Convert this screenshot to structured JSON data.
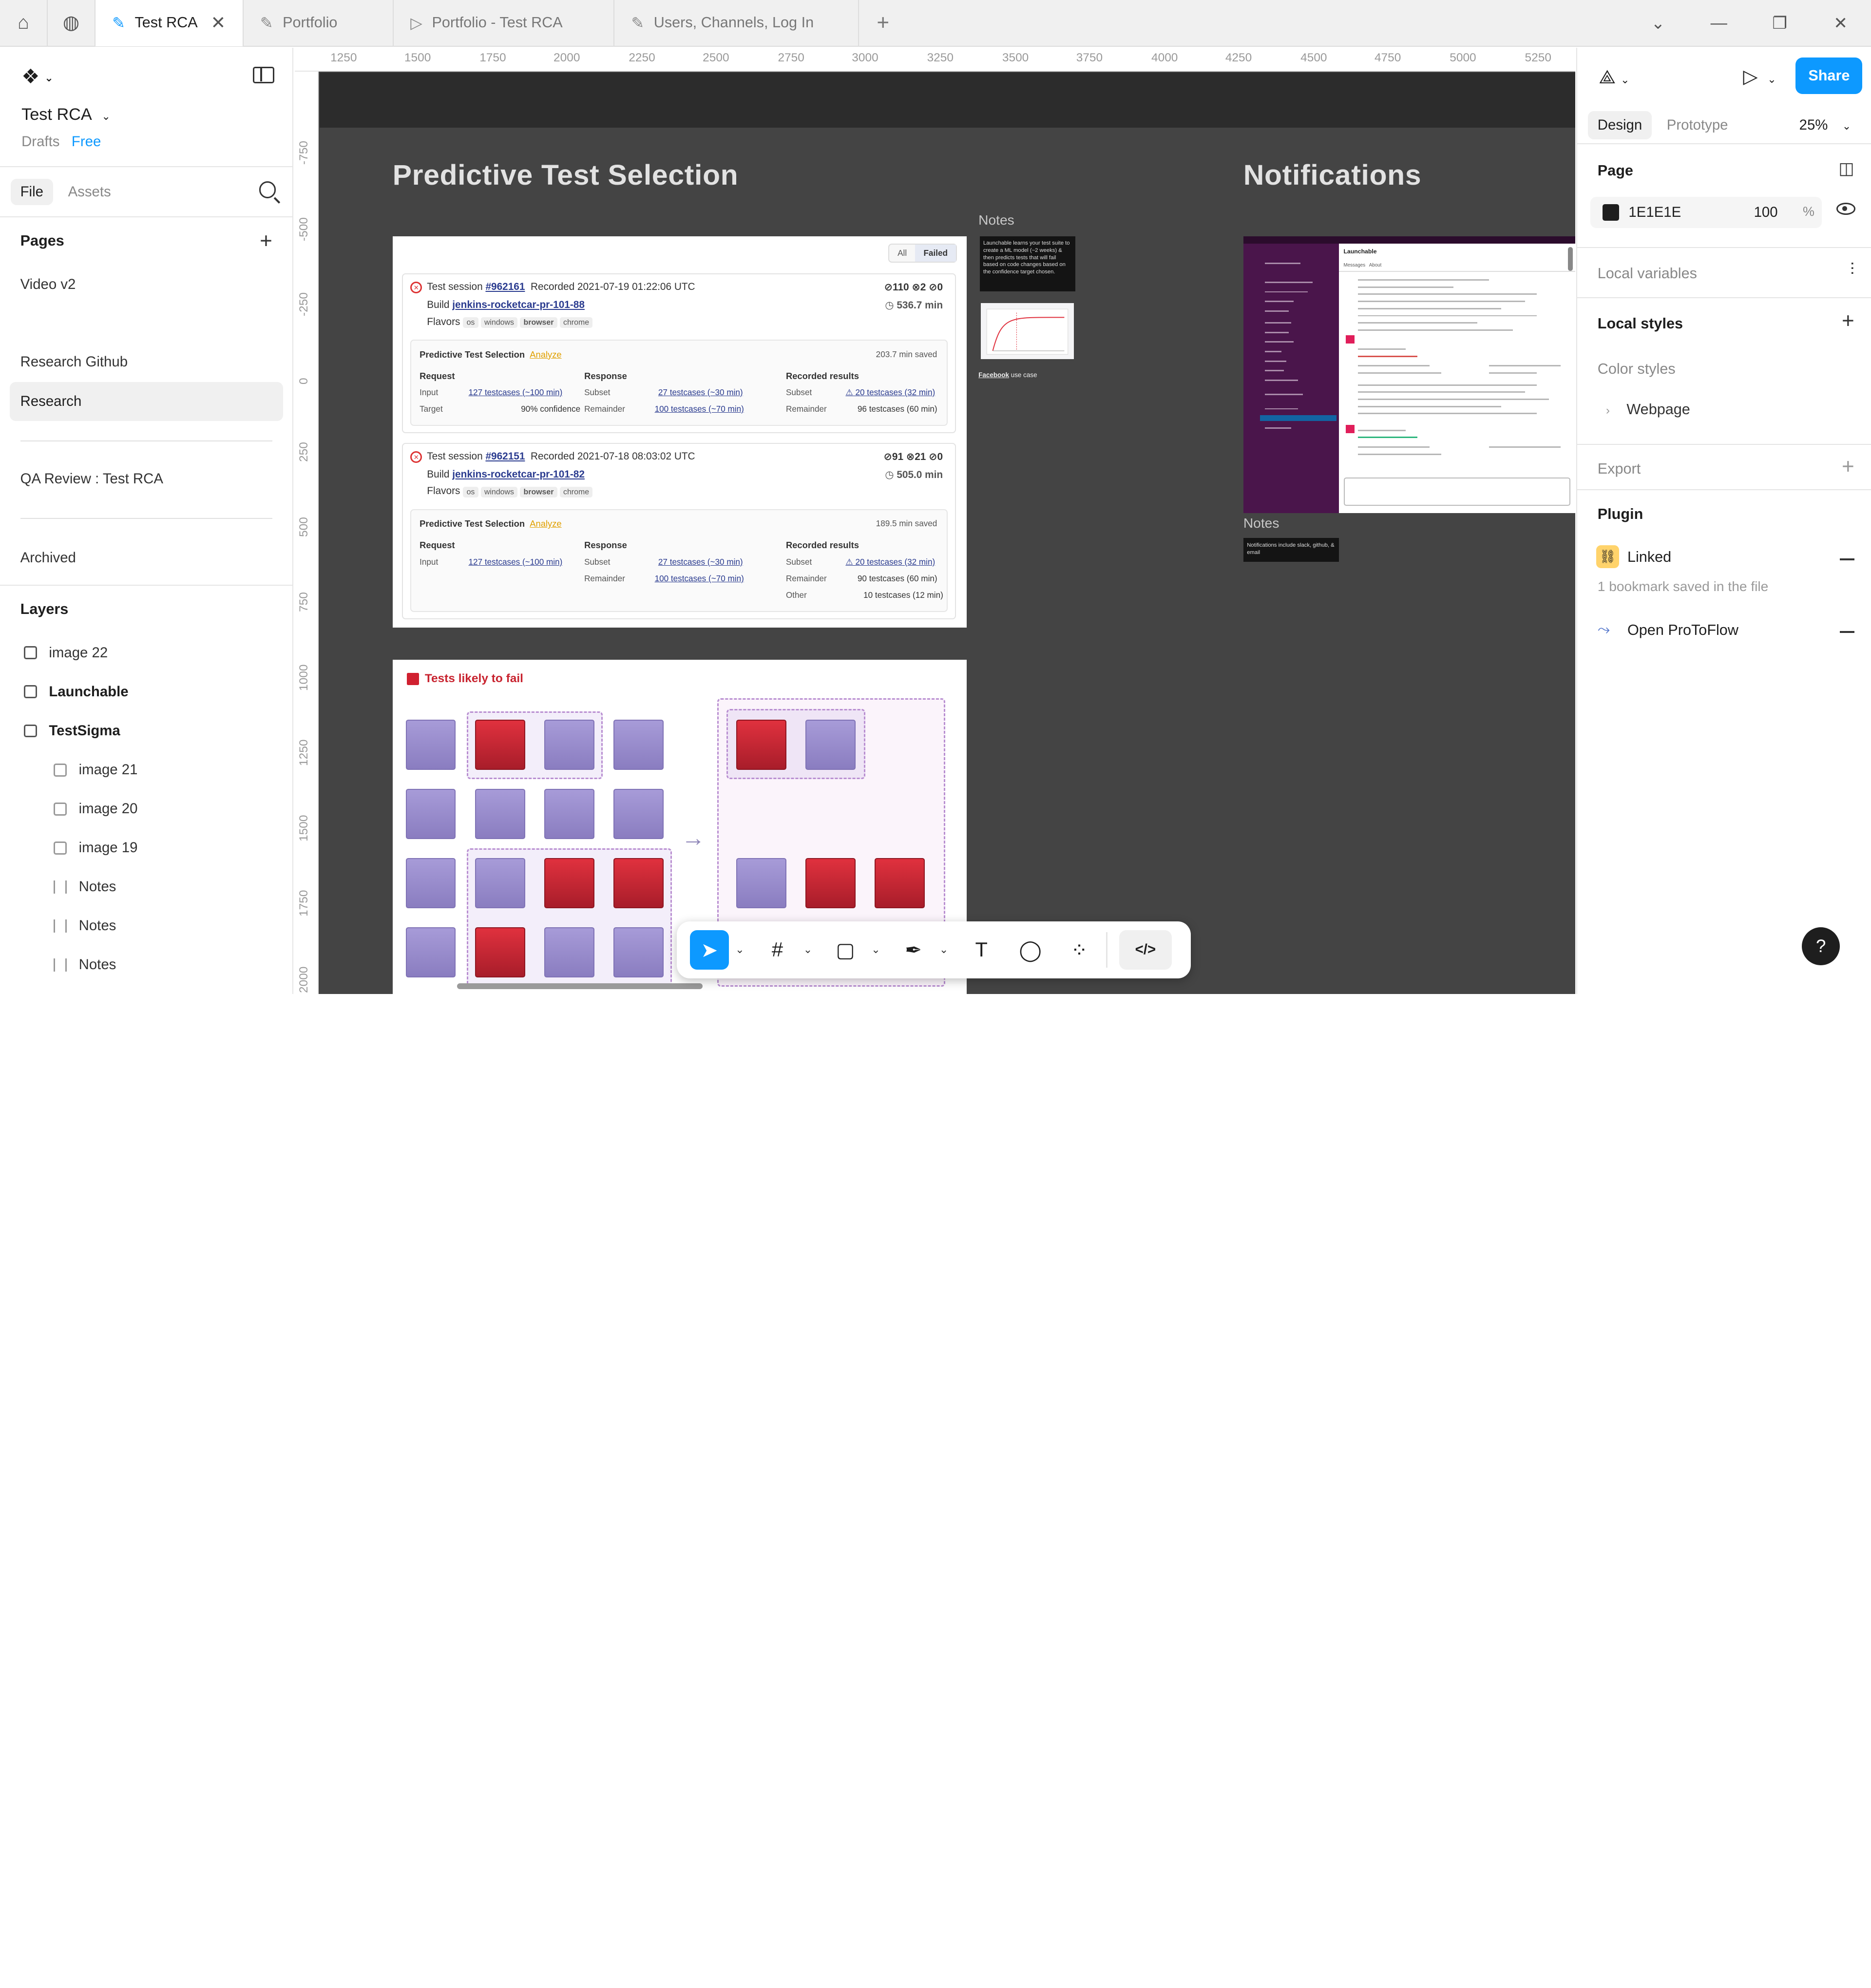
{
  "tabs": [
    {
      "label": "Test RCA",
      "active": true,
      "icon": "pen-nib-icon"
    },
    {
      "label": "Portfolio",
      "active": false,
      "icon": "pen-nib-icon"
    },
    {
      "label": "Portfolio - Test RCA",
      "active": false,
      "icon": "play-icon"
    },
    {
      "label": "Users, Channels, Log In",
      "active": false,
      "icon": "pen-nib-icon"
    }
  ],
  "left": {
    "file_name": "Test RCA",
    "drafts": "Drafts",
    "plan": "Free",
    "tab_file": "File",
    "tab_assets": "Assets",
    "pages_header": "Pages",
    "pages": [
      "Video v2",
      "Research Github",
      "Research",
      "QA Review : Test RCA",
      "Archived"
    ],
    "layers_header": "Layers",
    "layers": [
      {
        "label": "image 22",
        "icon": "image-icon"
      },
      {
        "label": "Launchable",
        "icon": "frame-icon"
      },
      {
        "label": "TestSigma",
        "icon": "frame-icon"
      },
      {
        "label": "image 21",
        "icon": "image-icon"
      },
      {
        "label": "image 20",
        "icon": "image-icon"
      },
      {
        "label": "image 19",
        "icon": "image-icon"
      },
      {
        "label": "Notes",
        "icon": "text-block-icon"
      },
      {
        "label": "Notes",
        "icon": "text-block-icon"
      },
      {
        "label": "Notes",
        "icon": "text-block-icon"
      }
    ]
  },
  "ruler": {
    "top": [
      "1250",
      "1500",
      "1750",
      "2000",
      "2250",
      "2500",
      "2750",
      "3000",
      "3250",
      "3500",
      "3750",
      "4000",
      "4250",
      "4500",
      "4750",
      "5000",
      "5250"
    ],
    "left": [
      "-750",
      "-500",
      "-250",
      "0",
      "250",
      "500",
      "750",
      "1000",
      "1250",
      "1500",
      "1750",
      "2000"
    ]
  },
  "canvas": {
    "title_pts": "Predictive Test Selection",
    "title_notif": "Notifications",
    "notes_label_1": "Notes",
    "notes_label_2": "Notes",
    "note_text_1": "Launchable learns your test suite to create a ML model (~2 weeks) & then predicts tests that will fail based on code changes based on the confidence target chosen.",
    "note_link": "Facebook",
    "note_link_rest": "use case",
    "note_text_2": "Notifications include slack, github, & email",
    "filter_all": "All",
    "filter_failed": "Failed",
    "sessions": [
      {
        "prefix": "Test session",
        "id": "#962161",
        "recorded": "Recorded 2021-07-19 01:22:06 UTC",
        "build_label": "Build",
        "build": "jenkins-rocketcar-pr-101-88",
        "flavors_label": "Flavors",
        "flavors": [
          "os",
          "windows",
          "browser",
          "chrome"
        ],
        "counts": "⊘110 ⊗2 ⊘0",
        "duration": "◷ 536.7 min",
        "pts_label": "Predictive Test Selection",
        "analyze": "Analyze",
        "saved": "203.7 min saved",
        "request_h": "Request",
        "response_h": "Response",
        "recorded_h": "Recorded results",
        "rows": [
          [
            "Input",
            "127 testcases (~100 min)",
            "Subset",
            "27 testcases (~30 min)",
            "Subset",
            "⚠ 20 testcases (32 min)"
          ],
          [
            "Target",
            "90% confidence",
            "Remainder",
            "100 testcases (~70 min)",
            "Remainder",
            "96 testcases (60 min)"
          ]
        ]
      },
      {
        "prefix": "Test session",
        "id": "#962151",
        "recorded": "Recorded 2021-07-18 08:03:02 UTC",
        "build_label": "Build",
        "build": "jenkins-rocketcar-pr-101-82",
        "flavors_label": "Flavors",
        "flavors": [
          "os",
          "windows",
          "browser",
          "chrome"
        ],
        "counts": "⊘91 ⊗21 ⊘0",
        "duration": "◷ 505.0 min",
        "pts_label": "Predictive Test Selection",
        "analyze": "Analyze",
        "saved": "189.5 min saved",
        "request_h": "Request",
        "response_h": "Response",
        "recorded_h": "Recorded results",
        "rows": [
          [
            "Input",
            "127 testcases (~100 min)",
            "Subset",
            "27 testcases (~30 min)",
            "Subset",
            "⚠ 20 testcases (32 min)"
          ],
          [
            "",
            "",
            "Remainder",
            "100 testcases (~70 min)",
            "Remainder",
            "90 testcases (60 min)"
          ],
          [
            "",
            "",
            "",
            "",
            "Other",
            "10 testcases (12 min)"
          ]
        ]
      }
    ],
    "tests_likely_to_fail": "Tests likely to fail",
    "slack_app": "Launchable",
    "slack_tabs": [
      "Messages",
      "About"
    ]
  },
  "toolbar": {
    "tools": [
      "move-tool",
      "frame-tool",
      "shape-tool",
      "pen-tool",
      "text-tool",
      "comment-tool",
      "actions-tool",
      "dev-mode-toggle"
    ]
  },
  "right": {
    "share": "Share",
    "tab_design": "Design",
    "tab_prototype": "Prototype",
    "zoom": "25%",
    "page_header": "Page",
    "bg_hex": "1E1E1E",
    "bg_opacity": "100",
    "bg_pct": "%",
    "local_variables": "Local variables",
    "local_styles": "Local styles",
    "color_styles": "Color styles",
    "webpage": "Webpage",
    "export": "Export",
    "plugin": "Plugin",
    "plugin_linked": "Linked",
    "plugin_linked_sub": "1 bookmark saved in the file",
    "plugin_protoflow": "Open ProToFlow"
  },
  "colors": {
    "accent": "#0d99ff",
    "canvas": "#444444",
    "fail_red": "#c8232f",
    "pass_purple": "#9b8fd0"
  }
}
